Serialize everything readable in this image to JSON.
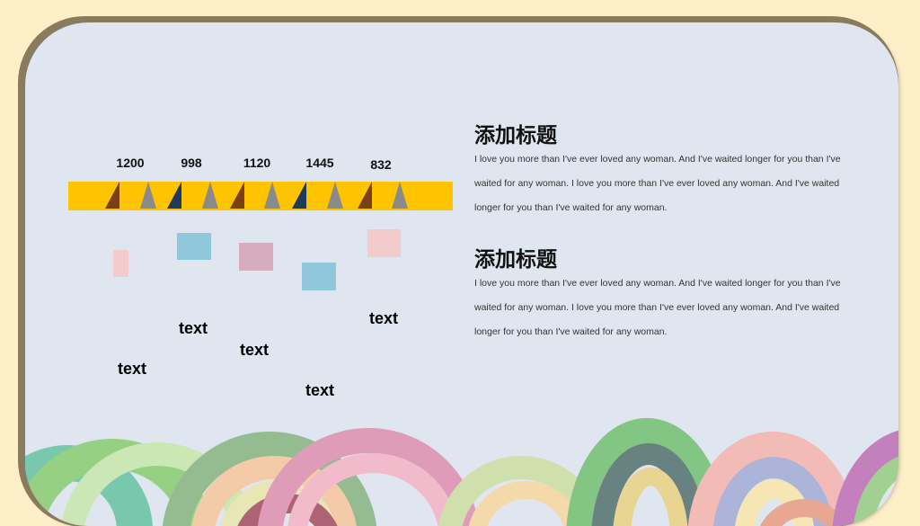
{
  "timeline": {
    "values": [
      "1200",
      "998",
      "1120",
      "1445",
      "832"
    ],
    "labels": [
      "text",
      "text",
      "text",
      "text",
      "text"
    ]
  },
  "sections": [
    {
      "title": "添加标题",
      "body": "I love you more than I've ever loved any woman. And I've waited longer for you than I've waited for any woman. I love you more than I've ever loved any woman. And I've waited longer for you than I've waited for any woman."
    },
    {
      "title": "添加标题",
      "body": "I love you more than I've ever loved any woman. And I've waited longer for you than I've waited for any woman. I love you more than I've ever loved any woman. And I've waited longer for you than I've waited for any woman."
    }
  ],
  "colors": {
    "page_background": "#fdf0c8",
    "panel_background": "#dfe6ef",
    "timeline_bar": "#ffc400",
    "marker_brown": "#7a3f12",
    "marker_navy": "#1f3a5a",
    "marker_gray": "#8a8a8a",
    "box_pink": "#f2cccd",
    "box_blue": "#8ec8da",
    "box_mauve": "#d5adbd"
  }
}
